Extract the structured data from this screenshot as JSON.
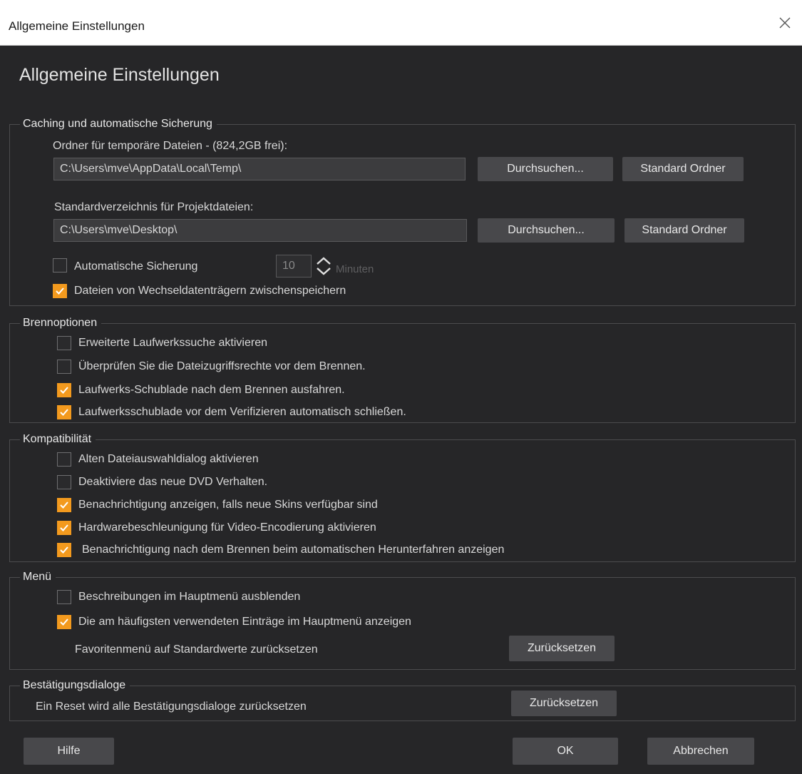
{
  "window": {
    "title": "Allgemeine Einstellungen"
  },
  "heading": "Allgemeine Einstellungen",
  "caching": {
    "title": "Caching und automatische Sicherung",
    "temp_label": "Ordner für temporäre Dateien - (824,2GB frei):",
    "temp_path": "C:\\Users\\mve\\AppData\\Local\\Temp\\",
    "project_label": "Standardverzeichnis für Projektdateien:",
    "project_path": "C:\\Users\\mve\\Desktop\\",
    "browse_label": "Durchsuchen...",
    "default_folder_label": "Standard Ordner",
    "autosave": {
      "label": "Automatische Sicherung",
      "checked": false,
      "value": "10",
      "unit": "Minuten"
    },
    "cache_removable": {
      "label": "Dateien von Wechseldatenträgern zwischenspeichern",
      "checked": true
    }
  },
  "burn": {
    "title": "Brennoptionen",
    "options": [
      {
        "label": "Erweiterte Laufwerkssuche aktivieren",
        "checked": false
      },
      {
        "label": "Überprüfen Sie die Dateizugriffsrechte vor dem Brennen.",
        "checked": false
      },
      {
        "label": "Laufwerks-Schublade nach dem Brennen ausfahren.",
        "checked": true
      },
      {
        "label": "Laufwerksschublade vor dem Verifizieren automatisch schließen.",
        "checked": true
      }
    ]
  },
  "compat": {
    "title": "Kompatibilität",
    "options": [
      {
        "label": "Alten Dateiauswahldialog aktivieren",
        "checked": false
      },
      {
        "label": "Deaktiviere das neue DVD Verhalten.",
        "checked": false
      },
      {
        "label": "Benachrichtigung anzeigen, falls neue Skins verfügbar sind",
        "checked": true
      },
      {
        "label": "Hardwarebeschleunigung für Video-Encodierung aktivieren",
        "checked": true
      },
      {
        "label": "Benachrichtigung nach dem Brennen beim automatischen Herunterfahren anzeigen",
        "checked": true
      }
    ]
  },
  "menu": {
    "title": "Menü",
    "options": [
      {
        "label": "Beschreibungen im Hauptmenü ausblenden",
        "checked": false
      },
      {
        "label": "Die am häufigsten verwendeten Einträge im Hauptmenü anzeigen",
        "checked": true
      }
    ],
    "reset_text": "Favoritenmenü auf Standardwerte zurücksetzen",
    "reset_label": "Zurücksetzen"
  },
  "confirm": {
    "title": "Bestätigungsdialoge",
    "reset_text": "Ein Reset wird alle Bestätigungsdialoge zurücksetzen",
    "reset_label": "Zurücksetzen"
  },
  "footer": {
    "help": "Hilfe",
    "ok": "OK",
    "cancel": "Abbrechen"
  },
  "colors": {
    "background": "#262628",
    "accent": "#f39a1e",
    "button": "#48484b"
  },
  "icons": {
    "close": "close-icon",
    "check": "checkmark-icon",
    "spin_up": "chevron-up-icon",
    "spin_down": "chevron-down-icon"
  }
}
